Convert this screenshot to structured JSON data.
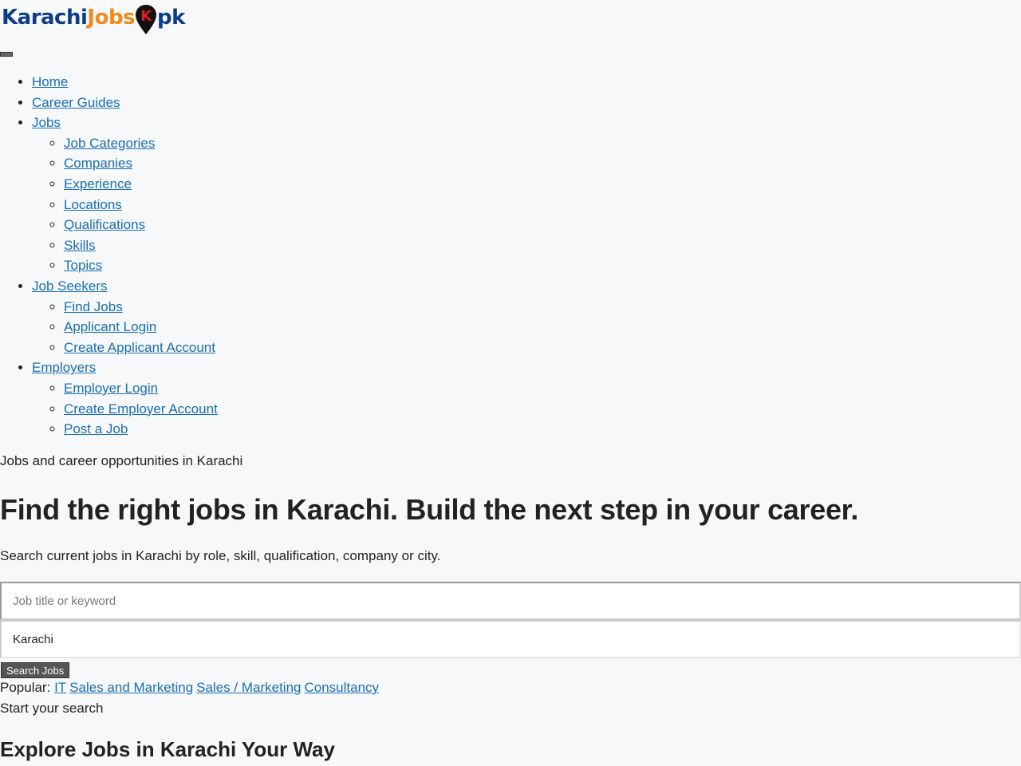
{
  "logo": {
    "part1": "Karachi",
    "part2": "Jobs",
    "part3": "pk",
    "pin_letter": "K",
    "colors": {
      "blue": "#0d3d8a",
      "orange": "#f08a1c",
      "pin": "#111111",
      "pin_letter": "#e11d1d"
    }
  },
  "nav": {
    "items": [
      {
        "label": "Home"
      },
      {
        "label": "Career Guides"
      },
      {
        "label": "Jobs",
        "suffix": "",
        "children": [
          {
            "label": "Job Categories"
          },
          {
            "label": "Companies"
          },
          {
            "label": "Experience"
          },
          {
            "label": "Locations"
          },
          {
            "label": "Qualifications"
          },
          {
            "label": "Skills"
          },
          {
            "label": "Topics"
          }
        ]
      },
      {
        "label": "Job Seekers",
        "children": [
          {
            "label": "Find Jobs"
          },
          {
            "label": "Applicant Login"
          },
          {
            "label": "Create Applicant Account"
          }
        ]
      },
      {
        "label": "Employers",
        "children": [
          {
            "label": "Employer Login"
          },
          {
            "label": "Create Employer Account"
          },
          {
            "label": "Post a Job"
          }
        ]
      }
    ]
  },
  "hero": {
    "tagline": "Jobs and career opportunities in Karachi",
    "title": "Find the right jobs in Karachi. Build the next step in your career.",
    "subtitle": "Search current jobs in Karachi by role, skill, qualification, company or city."
  },
  "search": {
    "keyword_placeholder": "Job title or keyword",
    "keyword_value": "",
    "location_value": "Karachi",
    "button_label": "Search Jobs"
  },
  "popular": {
    "label": "Popular:",
    "links": [
      "IT",
      "Sales and Marketing",
      "Sales / Marketing",
      "Consultancy"
    ]
  },
  "start_text": "Start your search",
  "explore_heading": "Explore Jobs in Karachi Your Way",
  "colors": {
    "link": "#1a6fb0",
    "background": "#f6f8fa",
    "text": "#222222"
  }
}
